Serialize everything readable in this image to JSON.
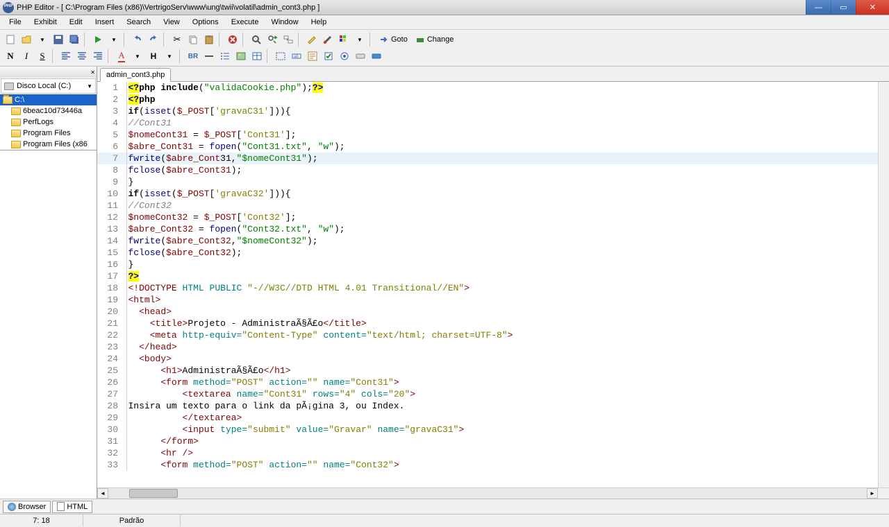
{
  "title": "PHP Editor - [ C:\\Program Files (x86)\\VertrigoServ\\www\\ung\\twii\\volatil\\admin_cont3.php ]",
  "menus": [
    "File",
    "Exhibit",
    "Edit",
    "Insert",
    "Search",
    "View",
    "Options",
    "Execute",
    "Window",
    "Help"
  ],
  "toolbar_goto": "Goto",
  "toolbar_change": "Change",
  "drive": "Disco Local (C:)",
  "tree": {
    "root": "C:\\",
    "items": [
      "6beac10d73446a",
      "PerfLogs",
      "Program Files",
      "Program Files (x86"
    ]
  },
  "tab": "admin_cont3.php",
  "code": [
    {
      "n": 1,
      "h": "<span class='hl-php'>&lt;?</span><span class='hl-kw'>php</span> <span class='hl-kw'>include</span>(<span class='hl-strdq'>\"validaCookie.php\"</span>);<span class='hl-php'>?&gt;</span>"
    },
    {
      "n": 2,
      "h": "<span class='hl-php'>&lt;?</span><span class='hl-kw'>php</span>"
    },
    {
      "n": 3,
      "h": "<span class='hl-kw'>if</span>(<span class='hl-fn'>isset</span>(<span class='hl-var'>$_POST</span>[<span class='hl-idx'>'gravaC31'</span>])){"
    },
    {
      "n": 4,
      "h": "<span class='hl-cmt'>//Cont31</span>"
    },
    {
      "n": 5,
      "h": "<span class='hl-var'>$nomeCont31</span> = <span class='hl-var'>$_POST</span>[<span class='hl-idx'>'Cont31'</span>];"
    },
    {
      "n": 6,
      "h": "<span class='hl-var'>$abre_Cont31</span> = <span class='hl-fn'>fopen</span>(<span class='hl-strdq'>\"Cont31.txt\"</span>, <span class='hl-strdq'>\"w\"</span>);"
    },
    {
      "n": 7,
      "h": "<span class='hl-fn'>fwrite</span>(<span class='hl-var'>$abre_Cont</span>31,<span class='hl-strdq'>\"$nomeCont31\"</span>);",
      "current": true
    },
    {
      "n": 8,
      "h": "<span class='hl-fn'>fclose</span>(<span class='hl-var'>$abre_Cont31</span>);"
    },
    {
      "n": 9,
      "h": "}"
    },
    {
      "n": 10,
      "h": "<span class='hl-kw'>if</span>(<span class='hl-fn'>isset</span>(<span class='hl-var'>$_POST</span>[<span class='hl-idx'>'gravaC32'</span>])){"
    },
    {
      "n": 11,
      "h": "<span class='hl-cmt'>//Cont32</span>"
    },
    {
      "n": 12,
      "h": "<span class='hl-var'>$nomeCont32</span> = <span class='hl-var'>$_POST</span>[<span class='hl-idx'>'Cont32'</span>];"
    },
    {
      "n": 13,
      "h": "<span class='hl-var'>$abre_Cont32</span> = <span class='hl-fn'>fopen</span>(<span class='hl-strdq'>\"Cont32.txt\"</span>, <span class='hl-strdq'>\"w\"</span>);"
    },
    {
      "n": 14,
      "h": "<span class='hl-fn'>fwrite</span>(<span class='hl-var'>$abre_Cont32</span>,<span class='hl-strdq'>\"$nomeCont32\"</span>);"
    },
    {
      "n": 15,
      "h": "<span class='hl-fn'>fclose</span>(<span class='hl-var'>$abre_Cont32</span>);"
    },
    {
      "n": 16,
      "h": "}"
    },
    {
      "n": 17,
      "h": "<span class='hl-php'>?&gt;</span>"
    },
    {
      "n": 18,
      "h": "<span class='hl-tag'>&lt;!DOCTYPE</span> <span class='hl-attr'>HTML PUBLIC</span> <span class='hl-str'>\"-//W3C//DTD HTML 4.01 Transitional//EN\"</span><span class='hl-tag'>&gt;</span>"
    },
    {
      "n": 19,
      "h": "<span class='hl-tag'>&lt;html&gt;</span>"
    },
    {
      "n": 20,
      "h": "  <span class='hl-tag'>&lt;head&gt;</span>"
    },
    {
      "n": 21,
      "h": "    <span class='hl-tag'>&lt;title&gt;</span>Projeto - AdministraÃ§Ã£o<span class='hl-tag'>&lt;/title&gt;</span>"
    },
    {
      "n": 22,
      "h": "    <span class='hl-tag'>&lt;meta</span> <span class='hl-attr'>http-equiv=</span><span class='hl-str'>\"Content-Type\"</span> <span class='hl-attr'>content=</span><span class='hl-str'>\"text/html; charset=UTF-8\"</span><span class='hl-tag'>&gt;</span>"
    },
    {
      "n": 23,
      "h": "  <span class='hl-tag'>&lt;/head&gt;</span>"
    },
    {
      "n": 24,
      "h": "  <span class='hl-tag'>&lt;body&gt;</span>"
    },
    {
      "n": 25,
      "h": "      <span class='hl-tag'>&lt;h1&gt;</span>AdministraÃ§Ã£o<span class='hl-tag'>&lt;/h1&gt;</span>"
    },
    {
      "n": 26,
      "h": "      <span class='hl-tag'>&lt;form</span> <span class='hl-attr'>method=</span><span class='hl-str'>\"POST\"</span> <span class='hl-attr'>action=</span><span class='hl-str'>\"\"</span> <span class='hl-attr'>name=</span><span class='hl-str'>\"Cont31\"</span><span class='hl-tag'>&gt;</span>"
    },
    {
      "n": 27,
      "h": "          <span class='hl-tag'>&lt;textarea</span> <span class='hl-attr'>name=</span><span class='hl-str'>\"Cont31\"</span> <span class='hl-attr'>rows=</span><span class='hl-str'>\"4\"</span> <span class='hl-attr'>cols=</span><span class='hl-str'>\"20\"</span><span class='hl-tag'>&gt;</span>"
    },
    {
      "n": 28,
      "h": "Insira um texto para o link da pÃ¡gina 3, ou Index."
    },
    {
      "n": 29,
      "h": "          <span class='hl-tag'>&lt;/textarea&gt;</span>"
    },
    {
      "n": 30,
      "h": "          <span class='hl-tag'>&lt;input</span> <span class='hl-attr'>type=</span><span class='hl-str'>\"submit\"</span> <span class='hl-attr'>value=</span><span class='hl-str'>\"Gravar\"</span> <span class='hl-attr'>name=</span><span class='hl-str'>\"gravaC31\"</span><span class='hl-tag'>&gt;</span>"
    },
    {
      "n": 31,
      "h": "      <span class='hl-tag'>&lt;/form&gt;</span>"
    },
    {
      "n": 32,
      "h": "      <span class='hl-tag'>&lt;hr /&gt;</span>"
    },
    {
      "n": 33,
      "h": "      <span class='hl-tag'>&lt;form</span> <span class='hl-attr'>method=</span><span class='hl-str'>\"POST\"</span> <span class='hl-attr'>action=</span><span class='hl-str'>\"\"</span> <span class='hl-attr'>name=</span><span class='hl-str'>\"Cont32\"</span><span class='hl-tag'>&gt;</span>"
    }
  ],
  "bottom_tabs": [
    "Browser",
    "HTML"
  ],
  "status": {
    "pos": "7: 18",
    "mode": "Padrão"
  }
}
